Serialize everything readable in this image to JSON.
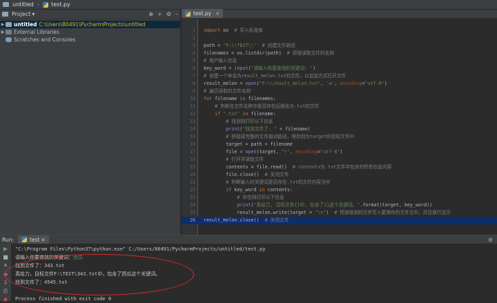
{
  "breadcrumb": {
    "project": "untitled",
    "file": "test.py"
  },
  "project_panel": {
    "title": "Project",
    "tree": [
      {
        "name": "untitled",
        "path": "C:\\Users\\80491\\PycharmProjects\\untitled"
      },
      {
        "name": "External Libraries"
      },
      {
        "name": "Scratches and Consoles"
      }
    ]
  },
  "editor": {
    "tab_label": "test.py",
    "lines": [
      {
        "n": "1",
        "code": "import os  # 导入标准库"
      },
      {
        "n": "2",
        "code": ""
      },
      {
        "n": "3",
        "code": "path = \"F:\\\\TEST\\\\\"  # 创建文件路径"
      },
      {
        "n": "4",
        "code": "filenames = os.listdir(path)  # 获取读取文件的名称"
      },
      {
        "n": "5",
        "code": "# 用户输入信息"
      },
      {
        "n": "6",
        "code": "key_word = input(\"请输入你要查找的关键词: \")"
      },
      {
        "n": "7",
        "code": "# 创建一个命名为result_melon.txt的文件，以追加方式打开文件"
      },
      {
        "n": "8",
        "code": "result_melon = open(\"F:\\\\result_melon.txt\", 'a', encoding=\"utf-8\")"
      },
      {
        "n": "9",
        "code": "# 遍历读取的文件名称"
      },
      {
        "n": "10",
        "code": "for filename in filenames:"
      },
      {
        "n": "11",
        "code": "    # 判断在文件名称中是否存在后缀名为.txt的文件"
      },
      {
        "n": "12",
        "code": "    if \".txt\" in filename:"
      },
      {
        "n": "13",
        "code": "        # 找到则打印以下信息"
      },
      {
        "n": "14",
        "code": "        print(\"找到文件了: \" + filename)"
      },
      {
        "n": "15",
        "code": "        # 拼接成完整的文件相对路径，保存到为target的目标文件中"
      },
      {
        "n": "16",
        "code": "        target = path + filename"
      },
      {
        "n": "17",
        "code": "        file = open(target, \"r\", encoding=\"utf-8\")"
      },
      {
        "n": "18",
        "code": "        # 打开并读取文件"
      },
      {
        "n": "19",
        "code": "        contents = file.read()  # contents为.txt文件中包含的所有信息内容"
      },
      {
        "n": "20",
        "code": "        file.close()  # 关闭文件"
      },
      {
        "n": "21",
        "code": "        # 判断输入的关键词是否存在.txt的文件内容当中"
      },
      {
        "n": "22",
        "code": "        if key_word in contents:"
      },
      {
        "n": "23",
        "code": "            # 存在则打印以下信息"
      },
      {
        "n": "24",
        "code": "            print(\"真给力, 目标文件{}中, 包含了{}这个关键词。\".format(target, key_word))"
      },
      {
        "n": "25",
        "code": "            result_melon.write(target + \"\\n\")  # 把读取到的文件写入要保存的文件当中，并且换行显示"
      },
      {
        "n": "26",
        "code": "result_melon.close()  # 关闭文件"
      }
    ]
  },
  "run_panel": {
    "label": "Run:",
    "tab": "test",
    "console": [
      "\"C:\\Program Files\\Python37\\python.exe\" C:/Users/80491/PycharmProjects/untitled/test.py",
      "请输入你要查找的关键词：",
      "找到文件了：343.txt",
      "真给力，目标文件F:\\TEST\\343.txt中，包含了西瓜这个关键词。",
      "找到文件了：4545.txt",
      "",
      "Process finished with exit code 0"
    ],
    "user_input": "西瓜"
  },
  "colors": {
    "annotation": "#d92b2b",
    "current_line": "#0d2d6b",
    "path_highlight": "#e6b422"
  }
}
